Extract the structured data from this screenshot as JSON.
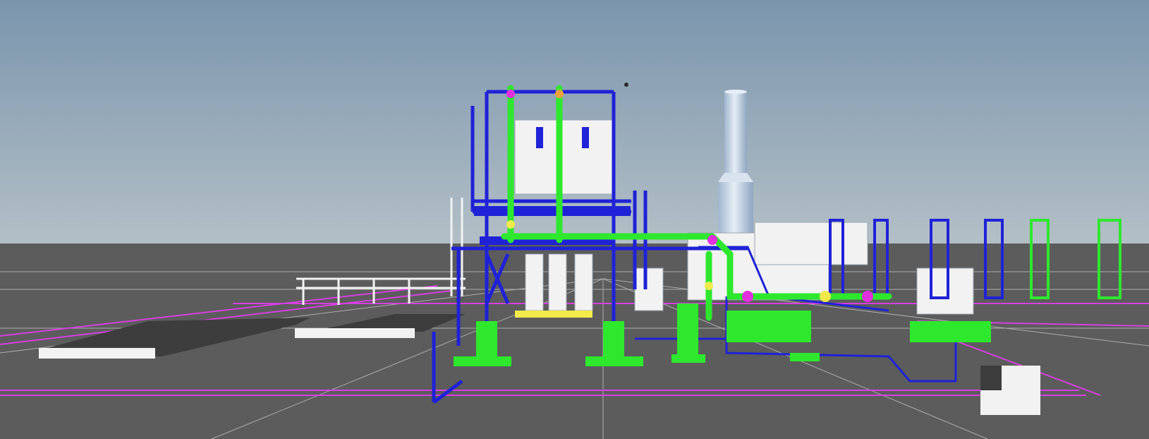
{
  "app": {
    "view": "3d-plant-model-viewport"
  },
  "colors": {
    "sky_top": "#7a95ad",
    "sky_horizon": "#b3bfc6",
    "ground": "#5c5c5c",
    "grid": "#c8c8c8",
    "boundary": "#d63fe0",
    "structure_blue": "#1f22d6",
    "pipe_green": "#2ee82e",
    "equipment_white": "#f2f2f2",
    "accent_magenta": "#e22fe0",
    "accent_yellow": "#f2e94b",
    "slab_dark": "#3d3d3d",
    "stack": "#c9d7e6"
  },
  "scene_objects": [
    {
      "name": "main-pipe-rack",
      "color": "structure_blue"
    },
    {
      "name": "green-riser-pipes",
      "color": "pipe_green"
    },
    {
      "name": "exhaust-stack",
      "color": "stack"
    },
    {
      "name": "compressor-skid",
      "color": "pipe_green"
    },
    {
      "name": "cooler-frames",
      "color": "structure_blue"
    },
    {
      "name": "white-equipment-module",
      "color": "equipment_white"
    },
    {
      "name": "foundation-slabs",
      "color": "slab_dark"
    },
    {
      "name": "plot-boundary-lines",
      "color": "boundary"
    },
    {
      "name": "ground-grid",
      "color": "grid"
    }
  ]
}
